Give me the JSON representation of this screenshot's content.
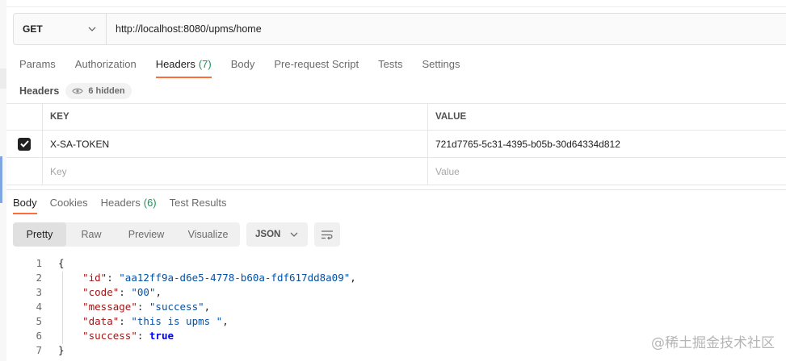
{
  "request": {
    "method": "GET",
    "url": "http://localhost:8080/upms/home"
  },
  "request_tabs": [
    {
      "label": "Params",
      "count": ""
    },
    {
      "label": "Authorization",
      "count": ""
    },
    {
      "label": "Headers",
      "count": "(7)"
    },
    {
      "label": "Body",
      "count": ""
    },
    {
      "label": "Pre-request Script",
      "count": ""
    },
    {
      "label": "Tests",
      "count": ""
    },
    {
      "label": "Settings",
      "count": ""
    }
  ],
  "active_request_tab": "Headers",
  "headers_section": {
    "label": "Headers",
    "hidden_label": "6 hidden",
    "columns": {
      "key": "KEY",
      "value": "VALUE"
    },
    "rows": [
      {
        "checked": true,
        "key": "X-SA-TOKEN",
        "value": "721d7765-5c31-4395-b05b-30d64334d812"
      }
    ],
    "placeholder": {
      "key": "Key",
      "value": "Value"
    }
  },
  "response_tabs": [
    {
      "label": "Body",
      "count": ""
    },
    {
      "label": "Cookies",
      "count": ""
    },
    {
      "label": "Headers",
      "count": "(6)"
    },
    {
      "label": "Test Results",
      "count": ""
    }
  ],
  "view_modes": [
    "Pretty",
    "Raw",
    "Preview",
    "Visualize"
  ],
  "active_view_mode": "Pretty",
  "format": "JSON",
  "body_lines": [
    {
      "num": "1",
      "tokens": [
        {
          "t": "p",
          "v": "{"
        }
      ]
    },
    {
      "num": "2",
      "tokens": [
        {
          "t": "p",
          "v": "    "
        },
        {
          "t": "k",
          "v": "\"id\""
        },
        {
          "t": "p",
          "v": ": "
        },
        {
          "t": "s",
          "v": "\"aa12ff9a-d6e5-4778-b60a-fdf617dd8a09\""
        },
        {
          "t": "p",
          "v": ","
        }
      ]
    },
    {
      "num": "3",
      "tokens": [
        {
          "t": "p",
          "v": "    "
        },
        {
          "t": "k",
          "v": "\"code\""
        },
        {
          "t": "p",
          "v": ": "
        },
        {
          "t": "s",
          "v": "\"00\""
        },
        {
          "t": "p",
          "v": ","
        }
      ]
    },
    {
      "num": "4",
      "tokens": [
        {
          "t": "p",
          "v": "    "
        },
        {
          "t": "k",
          "v": "\"message\""
        },
        {
          "t": "p",
          "v": ": "
        },
        {
          "t": "s",
          "v": "\"success\""
        },
        {
          "t": "p",
          "v": ","
        }
      ]
    },
    {
      "num": "5",
      "tokens": [
        {
          "t": "p",
          "v": "    "
        },
        {
          "t": "k",
          "v": "\"data\""
        },
        {
          "t": "p",
          "v": ": "
        },
        {
          "t": "s",
          "v": "\"this is upms \""
        },
        {
          "t": "p",
          "v": ","
        }
      ]
    },
    {
      "num": "6",
      "tokens": [
        {
          "t": "p",
          "v": "    "
        },
        {
          "t": "k",
          "v": "\"success\""
        },
        {
          "t": "p",
          "v": ": "
        },
        {
          "t": "b",
          "v": "true"
        }
      ]
    },
    {
      "num": "7",
      "tokens": [
        {
          "t": "p",
          "v": "}"
        }
      ]
    }
  ],
  "watermark": "@稀土掘金技术社区",
  "colors": {
    "accent_underline": "#ff6c37",
    "count_green": "#0b9b52"
  },
  "icons": [
    "chevron-down-icon",
    "eye-icon",
    "checkbox-icon",
    "wrap-lines-icon"
  ]
}
